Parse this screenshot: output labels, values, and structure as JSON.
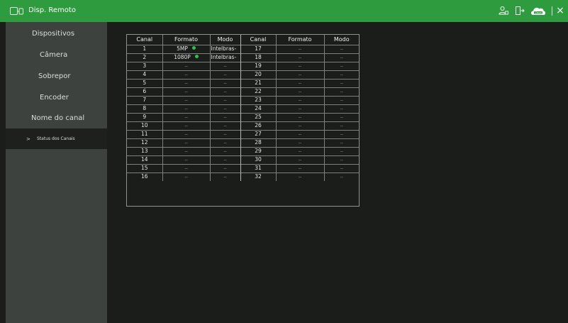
{
  "window": {
    "title": "Disp. Remoto",
    "accent_color": "#2e9b3e",
    "icons": [
      "remote-device-icon",
      "user-icon",
      "logout-icon",
      "cloud-icon",
      "close-icon"
    ],
    "cloud_badge": "Cloud",
    "close_glyph": "×"
  },
  "sidebar": {
    "items": [
      {
        "label": "Dispositivos",
        "active": false
      },
      {
        "label": "Câmera",
        "active": false
      },
      {
        "label": "Sobrepor",
        "active": false
      },
      {
        "label": "Encoder",
        "active": false
      },
      {
        "label": "Nome do canal",
        "active": false
      },
      {
        "label": "Status dos Canais",
        "active": true
      }
    ],
    "active_marker": ">"
  },
  "table": {
    "headers": [
      "Canal",
      "Formato",
      "Modo",
      "Canal",
      "Formato",
      "Modo"
    ],
    "rows": [
      {
        "ch1": "1",
        "fmt1": "5MP",
        "online1": true,
        "mode1": "Intelbras-",
        "ch2": "17",
        "fmt2": "--",
        "mode2": "--"
      },
      {
        "ch1": "2",
        "fmt1": "1080P",
        "online1": true,
        "mode1": "Intelbras-",
        "ch2": "18",
        "fmt2": "--",
        "mode2": "--"
      },
      {
        "ch1": "3",
        "fmt1": "--",
        "online1": false,
        "mode1": "--",
        "ch2": "19",
        "fmt2": "--",
        "mode2": "--"
      },
      {
        "ch1": "4",
        "fmt1": "--",
        "online1": false,
        "mode1": "--",
        "ch2": "20",
        "fmt2": "--",
        "mode2": "--"
      },
      {
        "ch1": "5",
        "fmt1": "--",
        "online1": false,
        "mode1": "--",
        "ch2": "21",
        "fmt2": "--",
        "mode2": "--"
      },
      {
        "ch1": "6",
        "fmt1": "--",
        "online1": false,
        "mode1": "--",
        "ch2": "22",
        "fmt2": "--",
        "mode2": "--"
      },
      {
        "ch1": "7",
        "fmt1": "--",
        "online1": false,
        "mode1": "--",
        "ch2": "23",
        "fmt2": "--",
        "mode2": "--"
      },
      {
        "ch1": "8",
        "fmt1": "--",
        "online1": false,
        "mode1": "--",
        "ch2": "24",
        "fmt2": "--",
        "mode2": "--"
      },
      {
        "ch1": "9",
        "fmt1": "--",
        "online1": false,
        "mode1": "--",
        "ch2": "25",
        "fmt2": "--",
        "mode2": "--"
      },
      {
        "ch1": "10",
        "fmt1": "--",
        "online1": false,
        "mode1": "--",
        "ch2": "26",
        "fmt2": "--",
        "mode2": "--"
      },
      {
        "ch1": "11",
        "fmt1": "--",
        "online1": false,
        "mode1": "--",
        "ch2": "27",
        "fmt2": "--",
        "mode2": "--"
      },
      {
        "ch1": "12",
        "fmt1": "--",
        "online1": false,
        "mode1": "--",
        "ch2": "28",
        "fmt2": "--",
        "mode2": "--"
      },
      {
        "ch1": "13",
        "fmt1": "--",
        "online1": false,
        "mode1": "--",
        "ch2": "29",
        "fmt2": "--",
        "mode2": "--"
      },
      {
        "ch1": "14",
        "fmt1": "--",
        "online1": false,
        "mode1": "--",
        "ch2": "30",
        "fmt2": "--",
        "mode2": "--"
      },
      {
        "ch1": "15",
        "fmt1": "--",
        "online1": false,
        "mode1": "--",
        "ch2": "31",
        "fmt2": "--",
        "mode2": "--"
      },
      {
        "ch1": "16",
        "fmt1": "--",
        "online1": false,
        "mode1": "--",
        "ch2": "32",
        "fmt2": "--",
        "mode2": "--"
      }
    ],
    "status_color_online": "#29c64a"
  }
}
